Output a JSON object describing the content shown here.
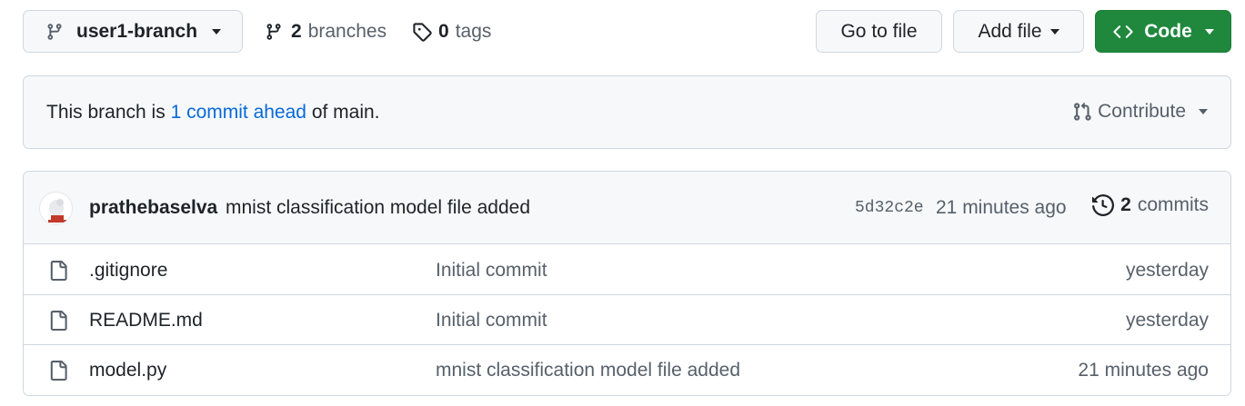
{
  "toolbar": {
    "branch_name": "user1-branch",
    "branches_count": "2",
    "branches_label": "branches",
    "tags_count": "0",
    "tags_label": "tags",
    "goto_file_label": "Go to file",
    "add_file_label": "Add file",
    "code_label": "Code"
  },
  "ahead": {
    "prefix": "This branch is ",
    "link_text": "1 commit ahead",
    "suffix": " of main.",
    "contribute_label": "Contribute"
  },
  "latest_commit": {
    "author": "prathebaselva",
    "message": "mnist classification model file added",
    "sha": "5d32c2e",
    "time": "21 minutes ago",
    "commits_count": "2",
    "commits_label": "commits"
  },
  "files": [
    {
      "name": ".gitignore",
      "commit": "Initial commit",
      "time": "yesterday",
      "icon": "file-icon"
    },
    {
      "name": "README.md",
      "commit": "Initial commit",
      "time": "yesterday",
      "icon": "file-icon"
    },
    {
      "name": "model.py",
      "commit": "mnist classification model file added",
      "time": "21 minutes ago",
      "icon": "file-icon"
    }
  ],
  "colors": {
    "accent_green": "#1f883d",
    "link_blue": "#0969da",
    "muted_text": "#57606a",
    "border": "#d0d7de",
    "subtle_bg": "#f6f8fa"
  }
}
